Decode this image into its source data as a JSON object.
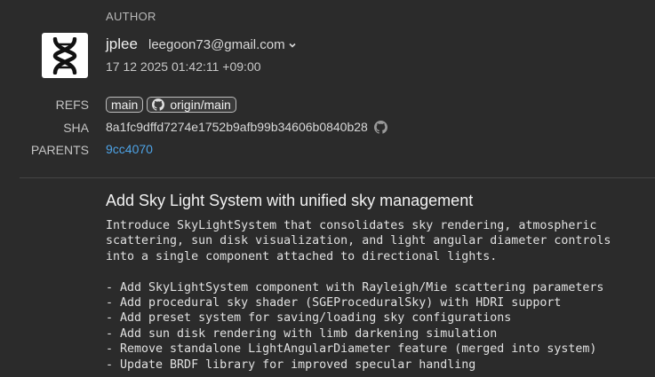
{
  "author": {
    "section_label": "AUTHOR",
    "name": "jplee",
    "email": "leegoon73@gmail.com",
    "date": "17 12 2025 01:42:11 +09:00",
    "avatar_icon": "dna-helix-icon"
  },
  "meta": {
    "refs_label": "REFS",
    "sha_label": "SHA",
    "parents_label": "PARENTS",
    "refs": [
      {
        "label": "main",
        "icon": null
      },
      {
        "label": "origin/main",
        "icon": "github-icon"
      }
    ],
    "sha": "8a1fc9dffd7274e1752b9afb99b34606b0840b28",
    "parent": "9cc4070"
  },
  "commit": {
    "title": "Add Sky Light System with unified sky management",
    "body": [
      "Introduce SkyLightSystem that consolidates sky rendering, atmospheric",
      "scattering, sun disk visualization, and light angular diameter controls",
      "into a single component attached to directional lights.",
      "",
      "- Add SkyLightSystem component with Rayleigh/Mie scattering parameters",
      "- Add procedural sky shader (SGEProceduralSky) with HDRI support",
      "- Add preset system for saving/loading sky configurations",
      "- Add sun disk rendering with limb darkening simulation",
      "- Remove standalone LightAngularDiameter feature (merged into system)",
      "- Update BRDF library for improved specular handling"
    ]
  },
  "colors": {
    "background": "#2b2b2b",
    "link": "#4ea3e6",
    "divider": "#454545"
  }
}
